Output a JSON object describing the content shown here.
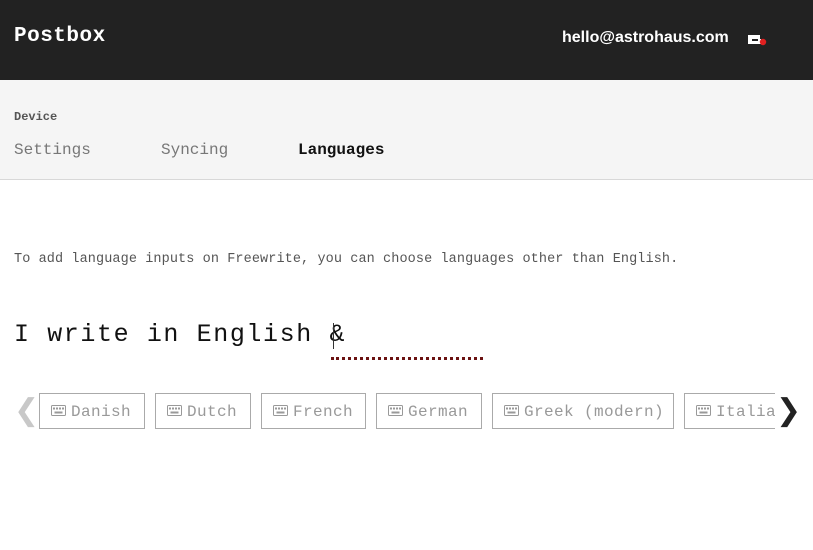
{
  "header": {
    "brand": "Postbox",
    "account_email": "hello@astrohaus.com",
    "inbox_icon": "inbox-tray-icon",
    "notification_color": "#e02020"
  },
  "subnav": {
    "section_label": "Device",
    "tabs": [
      {
        "label": "Settings",
        "active": false
      },
      {
        "label": "Syncing",
        "active": false
      },
      {
        "label": "Languages",
        "active": true
      }
    ]
  },
  "main": {
    "intro": "To add language inputs on Freewrite, you can choose languages other than English.",
    "sentence_prefix": "I write in English &",
    "language_input_value": "",
    "languages": [
      {
        "label": "Danish",
        "icon": "keyboard-icon"
      },
      {
        "label": "Dutch",
        "icon": "keyboard-icon"
      },
      {
        "label": "French",
        "icon": "keyboard-icon"
      },
      {
        "label": "German",
        "icon": "keyboard-icon"
      },
      {
        "label": "Greek (modern)",
        "icon": "keyboard-icon"
      },
      {
        "label": "Italian",
        "icon": "keyboard-icon"
      }
    ],
    "prev_icon": "chevron-left-icon",
    "next_icon": "chevron-right-icon"
  },
  "colors": {
    "header_bg": "#222222",
    "subnav_bg": "#f5f5f5",
    "input_underline": "#6b1212",
    "chip_text": "#999999"
  }
}
